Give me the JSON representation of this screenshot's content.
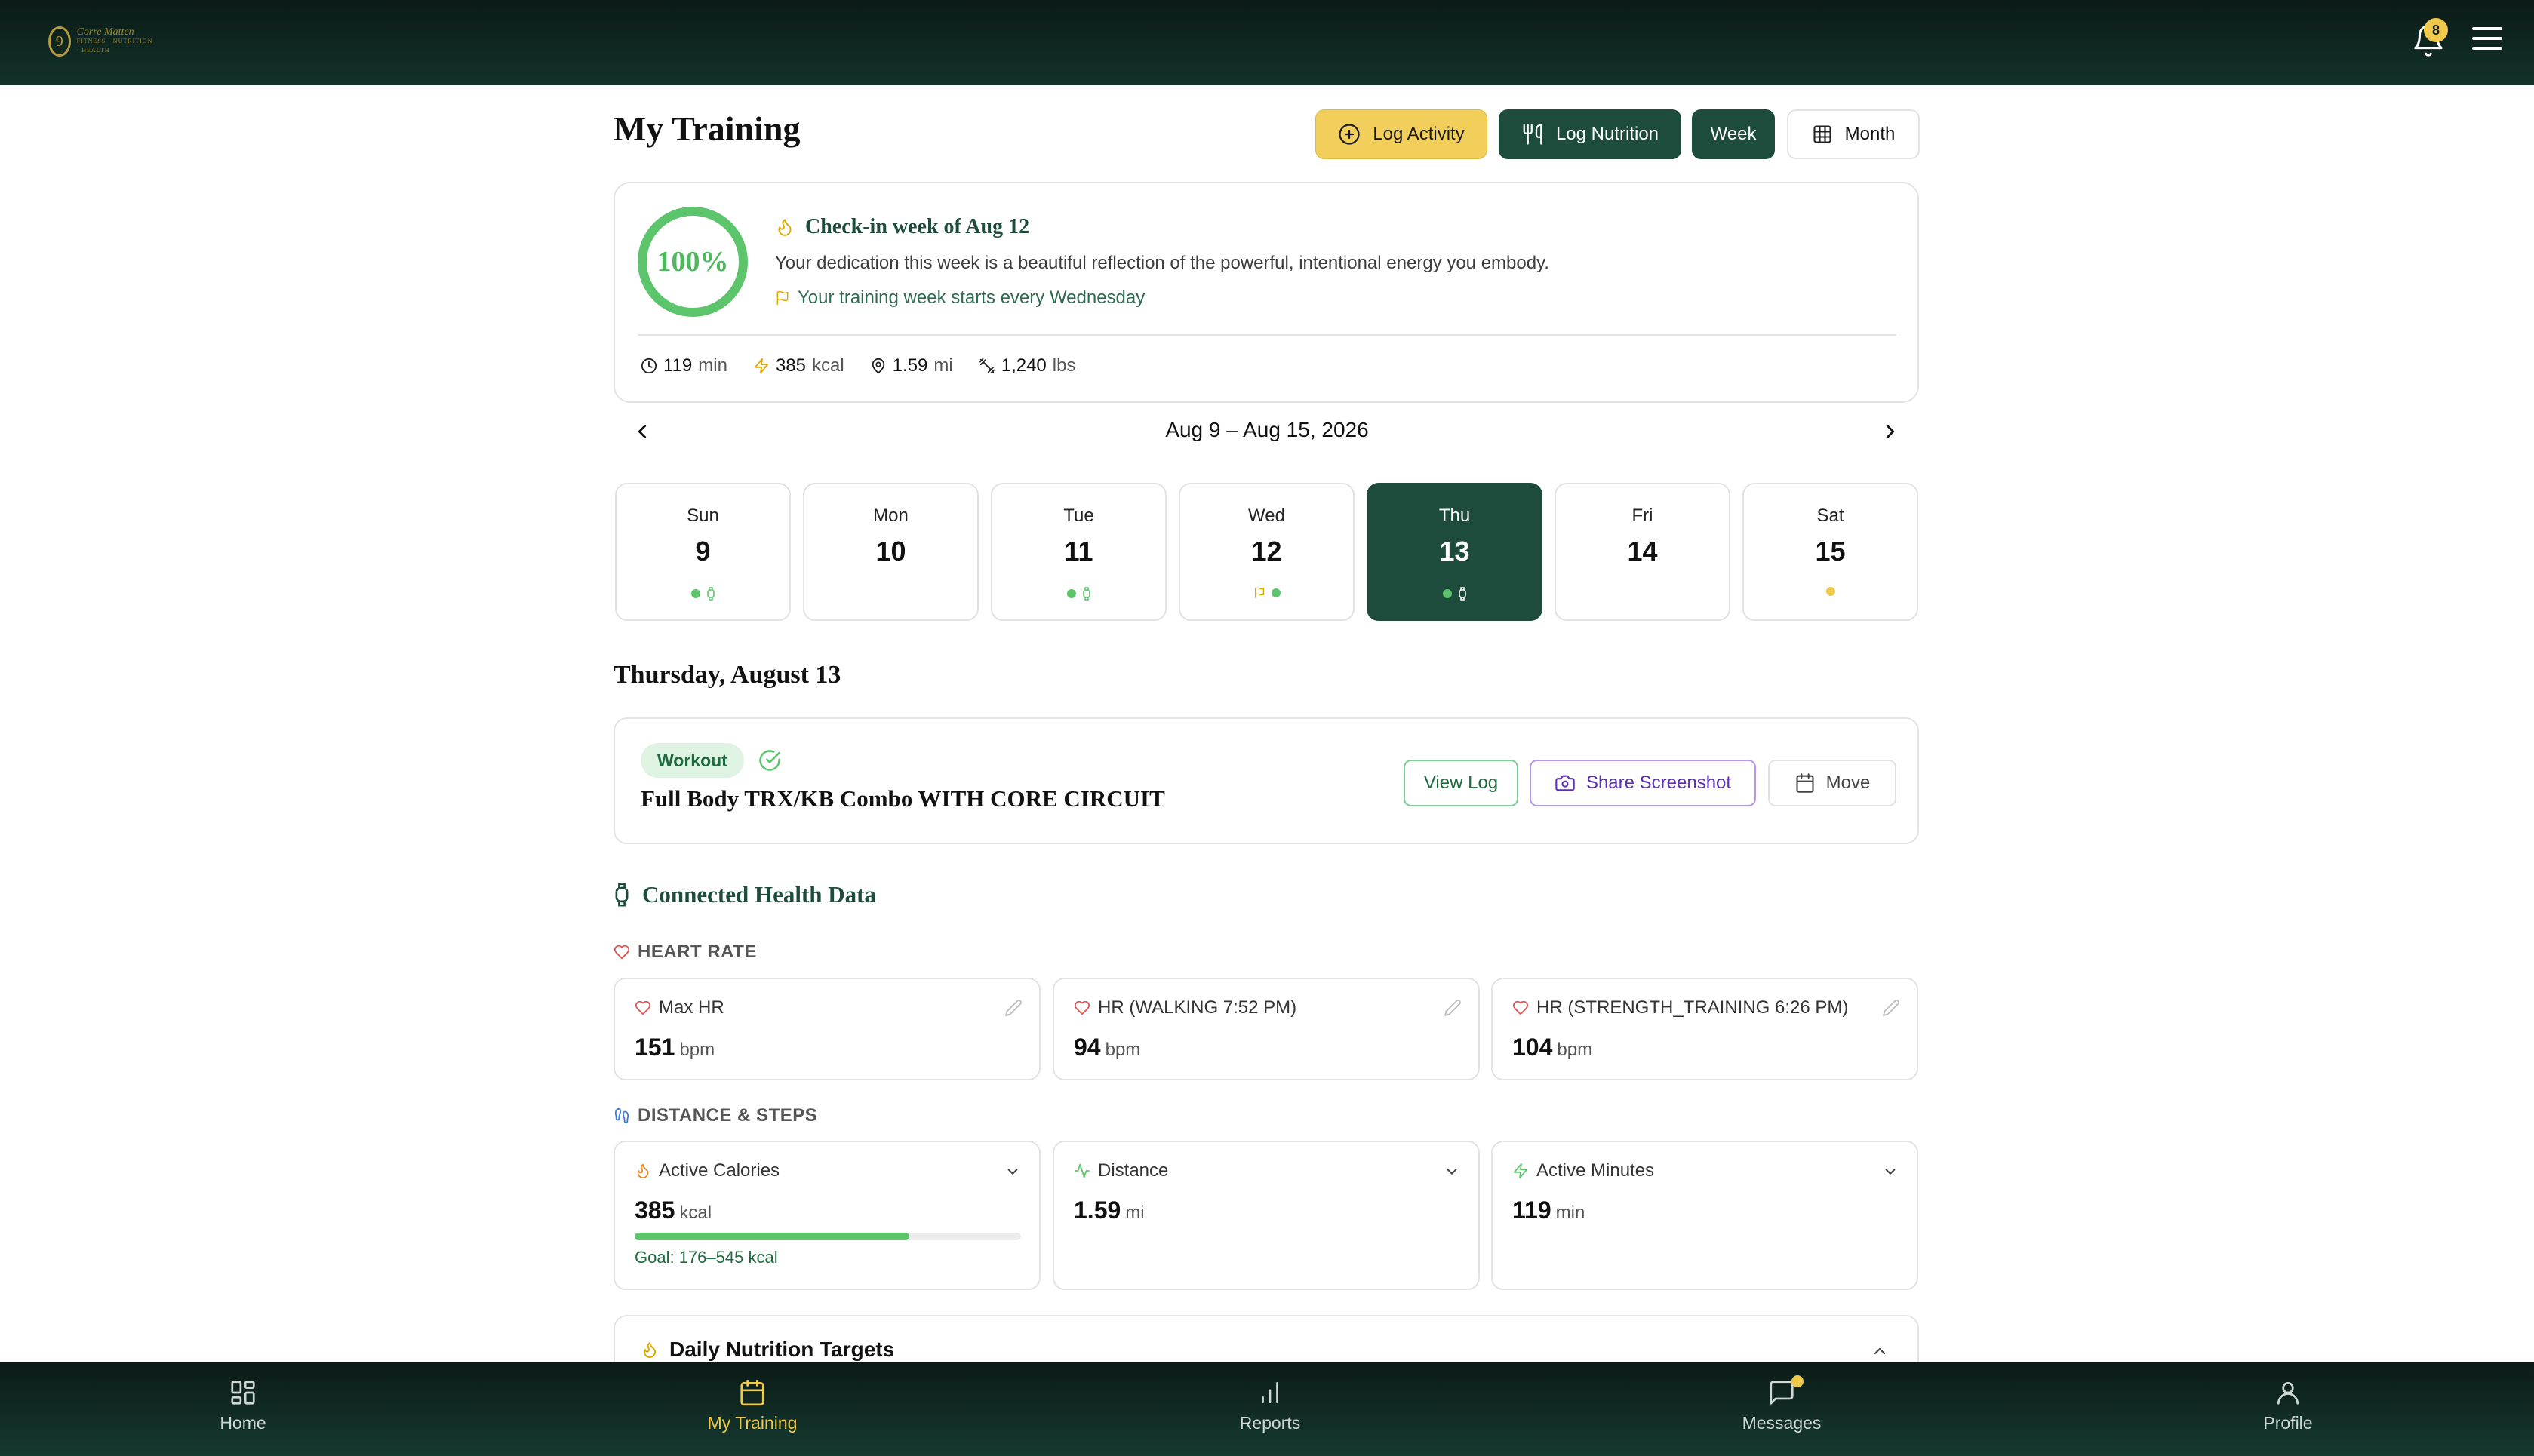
{
  "header": {
    "logo_initial": "9",
    "logo_script": "Corre Matten",
    "logo_small": "FITNESS · NUTRITION · HEALTH",
    "notifications_count": "8"
  },
  "page": {
    "title": "My Training",
    "actions": {
      "log_activity": "Log Activity",
      "log_nutrition": "Log Nutrition",
      "week": "Week",
      "month": "Month"
    }
  },
  "checkin": {
    "percent": "100%",
    "progress": 1.0,
    "title": "Check-in week of Aug 12",
    "message": "Your dedication this week is a beautiful reflection of the powerful, intentional energy you embody.",
    "week_start": "Your training week starts every Wednesday",
    "stats": {
      "minutes_value": "119",
      "minutes_unit": "min",
      "kcal_value": "385",
      "kcal_unit": "kcal",
      "distance_value": "1.59",
      "distance_unit": "mi",
      "weight_value": "1,240",
      "weight_unit": "lbs"
    }
  },
  "week_nav": {
    "range": "Aug 9 – Aug 15, 2026"
  },
  "days": [
    {
      "name": "Sun",
      "date": "9"
    },
    {
      "name": "Mon",
      "date": "10"
    },
    {
      "name": "Tue",
      "date": "11"
    },
    {
      "name": "Wed",
      "date": "12"
    },
    {
      "name": "Thu",
      "date": "13"
    },
    {
      "name": "Fri",
      "date": "14"
    },
    {
      "name": "Sat",
      "date": "15"
    }
  ],
  "selected_day": {
    "heading": "Thursday, August 13"
  },
  "workout": {
    "tag": "Workout",
    "title": "Full Body TRX/KB Combo WITH CORE CIRCUIT",
    "view_log": "View Log",
    "share": "Share Screenshot",
    "move": "Move"
  },
  "health": {
    "title": "Connected Health Data",
    "heart_rate_label": "HEART RATE",
    "heart_rate": [
      {
        "label": "Max HR",
        "value": "151",
        "unit": "bpm"
      },
      {
        "label": "HR (WALKING 7:52 PM)",
        "value": "94",
        "unit": "bpm"
      },
      {
        "label": "HR (STRENGTH_TRAINING 6:26 PM)",
        "value": "104",
        "unit": "bpm"
      }
    ],
    "distance_label": "DISTANCE & STEPS",
    "distance": [
      {
        "label": "Active Calories",
        "value": "385",
        "unit": "kcal",
        "goal": "Goal: 176–545 kcal",
        "progress": 0.71
      },
      {
        "label": "Distance",
        "value": "1.59",
        "unit": "mi"
      },
      {
        "label": "Active Minutes",
        "value": "119",
        "unit": "min"
      }
    ]
  },
  "nutrition": {
    "title": "Daily Nutrition Targets"
  },
  "bottom_nav": {
    "home": "Home",
    "my_training": "My Training",
    "reports": "Reports",
    "messages": "Messages",
    "profile": "Profile"
  },
  "colors": {
    "brand_dark": "#1d4b3c",
    "accent_yellow": "#f2cf5b",
    "success_green": "#5cc56c"
  }
}
